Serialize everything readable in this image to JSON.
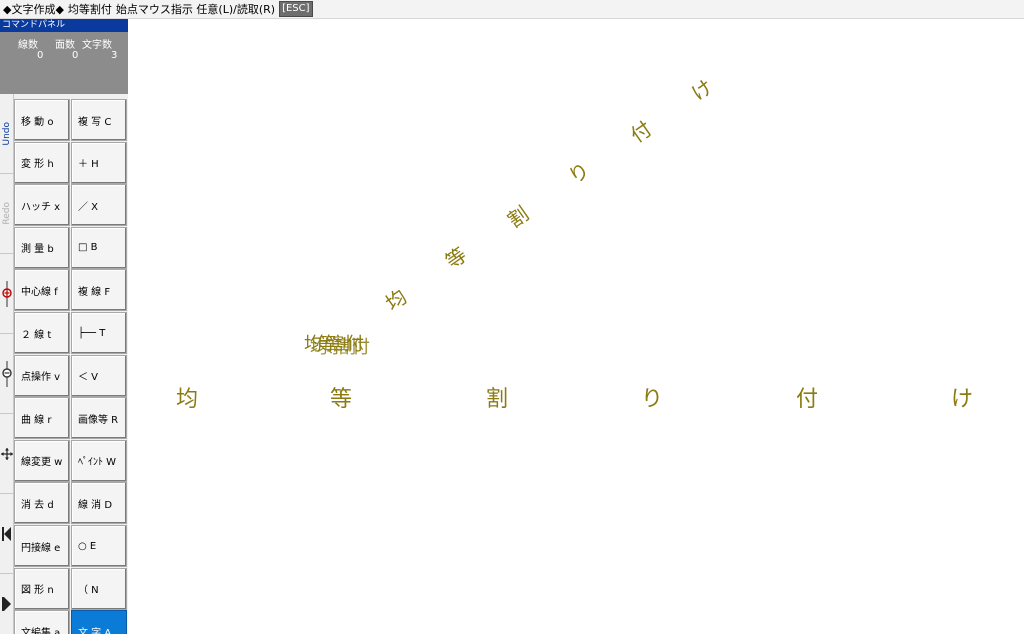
{
  "status": {
    "mode": "◆文字作成◆",
    "command": "均等割付",
    "hint": "始点マウス指示 任意(L)/読取(R)",
    "esc": "[ESC]"
  },
  "panel": {
    "title": "コマンドパネル",
    "counts": {
      "line_label": "線数",
      "face_label": "面数",
      "char_label": "文字数",
      "line_value": "0",
      "face_value": "0",
      "char_value": "3"
    },
    "side": {
      "undo": "Undo",
      "redo": "Redo"
    },
    "commands": [
      [
        "移 動 o",
        "複 写 C"
      ],
      [
        "変 形 h",
        "＋ H"
      ],
      [
        "ハッチ x",
        "／ X"
      ],
      [
        "測 量 b",
        "□ B"
      ],
      [
        "中心線 f",
        "複 線 F"
      ],
      [
        "２ 線 t",
        "├── T"
      ],
      [
        "点操作 v",
        "＜ V"
      ],
      [
        "曲 線 r",
        "画像等 R"
      ],
      [
        "線変更 w",
        "ﾍﾟｲﾝﾄ W"
      ],
      [
        "消 去 d",
        "線 消 D"
      ],
      [
        "円接線 e",
        "○ E"
      ],
      [
        "図 形 n",
        "（ N"
      ],
      [
        "文編集 a",
        "文 字 A"
      ]
    ]
  },
  "canvas": {
    "horizontal_chars": [
      "均",
      "等",
      "割",
      "り",
      "付",
      "け"
    ],
    "diagonal_chars": [
      "均",
      "等",
      "割",
      "り",
      "付",
      "け"
    ],
    "overlap_text": "均等割付",
    "text_color": "#8a7a10",
    "active_color": "#0a7bd6"
  }
}
